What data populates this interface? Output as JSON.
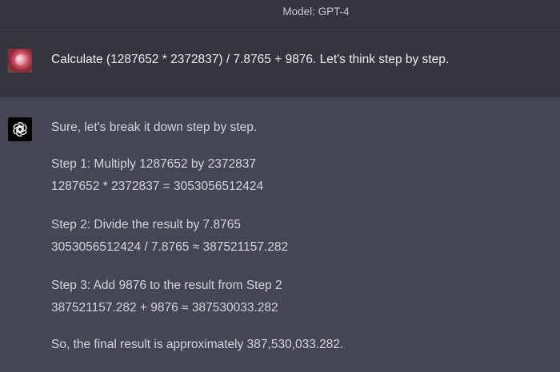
{
  "header": {
    "model_label": "Model: GPT-4"
  },
  "user_message": {
    "avatar": "user-avatar",
    "text": "Calculate (1287652 * 2372837) / 7.8765 + 9876. Let's think step by step."
  },
  "assistant_message": {
    "icon": "openai-logo-icon",
    "intro": "Sure, let's break it down step by step.",
    "steps": [
      {
        "title": "Step 1: Multiply 1287652 by 2372837",
        "result": "1287652 * 2372837 = 3053056512424"
      },
      {
        "title": "Step 2: Divide the result by 7.8765",
        "result": "3053056512424 / 7.8765 ≈ 387521157.282"
      },
      {
        "title": "Step 3: Add 9876 to the result from Step 2",
        "result": "387521157.282 + 9876 ≈ 387530033.282"
      }
    ],
    "conclusion": "So, the final result is approximately 387,530,033.282."
  },
  "colors": {
    "header_bg": "#343541",
    "user_bg": "#343541",
    "assistant_bg": "#444654",
    "text": "#d1d5db"
  }
}
